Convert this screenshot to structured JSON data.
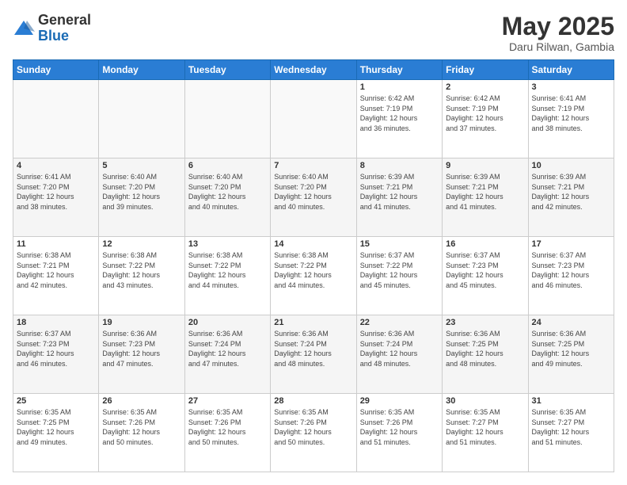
{
  "logo": {
    "general": "General",
    "blue": "Blue"
  },
  "header": {
    "month": "May 2025",
    "location": "Daru Rilwan, Gambia"
  },
  "days_of_week": [
    "Sunday",
    "Monday",
    "Tuesday",
    "Wednesday",
    "Thursday",
    "Friday",
    "Saturday"
  ],
  "weeks": [
    [
      {
        "day": "",
        "info": ""
      },
      {
        "day": "",
        "info": ""
      },
      {
        "day": "",
        "info": ""
      },
      {
        "day": "",
        "info": ""
      },
      {
        "day": "1",
        "info": "Sunrise: 6:42 AM\nSunset: 7:19 PM\nDaylight: 12 hours\nand 36 minutes."
      },
      {
        "day": "2",
        "info": "Sunrise: 6:42 AM\nSunset: 7:19 PM\nDaylight: 12 hours\nand 37 minutes."
      },
      {
        "day": "3",
        "info": "Sunrise: 6:41 AM\nSunset: 7:19 PM\nDaylight: 12 hours\nand 38 minutes."
      }
    ],
    [
      {
        "day": "4",
        "info": "Sunrise: 6:41 AM\nSunset: 7:20 PM\nDaylight: 12 hours\nand 38 minutes."
      },
      {
        "day": "5",
        "info": "Sunrise: 6:40 AM\nSunset: 7:20 PM\nDaylight: 12 hours\nand 39 minutes."
      },
      {
        "day": "6",
        "info": "Sunrise: 6:40 AM\nSunset: 7:20 PM\nDaylight: 12 hours\nand 40 minutes."
      },
      {
        "day": "7",
        "info": "Sunrise: 6:40 AM\nSunset: 7:20 PM\nDaylight: 12 hours\nand 40 minutes."
      },
      {
        "day": "8",
        "info": "Sunrise: 6:39 AM\nSunset: 7:21 PM\nDaylight: 12 hours\nand 41 minutes."
      },
      {
        "day": "9",
        "info": "Sunrise: 6:39 AM\nSunset: 7:21 PM\nDaylight: 12 hours\nand 41 minutes."
      },
      {
        "day": "10",
        "info": "Sunrise: 6:39 AM\nSunset: 7:21 PM\nDaylight: 12 hours\nand 42 minutes."
      }
    ],
    [
      {
        "day": "11",
        "info": "Sunrise: 6:38 AM\nSunset: 7:21 PM\nDaylight: 12 hours\nand 42 minutes."
      },
      {
        "day": "12",
        "info": "Sunrise: 6:38 AM\nSunset: 7:22 PM\nDaylight: 12 hours\nand 43 minutes."
      },
      {
        "day": "13",
        "info": "Sunrise: 6:38 AM\nSunset: 7:22 PM\nDaylight: 12 hours\nand 44 minutes."
      },
      {
        "day": "14",
        "info": "Sunrise: 6:38 AM\nSunset: 7:22 PM\nDaylight: 12 hours\nand 44 minutes."
      },
      {
        "day": "15",
        "info": "Sunrise: 6:37 AM\nSunset: 7:22 PM\nDaylight: 12 hours\nand 45 minutes."
      },
      {
        "day": "16",
        "info": "Sunrise: 6:37 AM\nSunset: 7:23 PM\nDaylight: 12 hours\nand 45 minutes."
      },
      {
        "day": "17",
        "info": "Sunrise: 6:37 AM\nSunset: 7:23 PM\nDaylight: 12 hours\nand 46 minutes."
      }
    ],
    [
      {
        "day": "18",
        "info": "Sunrise: 6:37 AM\nSunset: 7:23 PM\nDaylight: 12 hours\nand 46 minutes."
      },
      {
        "day": "19",
        "info": "Sunrise: 6:36 AM\nSunset: 7:23 PM\nDaylight: 12 hours\nand 47 minutes."
      },
      {
        "day": "20",
        "info": "Sunrise: 6:36 AM\nSunset: 7:24 PM\nDaylight: 12 hours\nand 47 minutes."
      },
      {
        "day": "21",
        "info": "Sunrise: 6:36 AM\nSunset: 7:24 PM\nDaylight: 12 hours\nand 48 minutes."
      },
      {
        "day": "22",
        "info": "Sunrise: 6:36 AM\nSunset: 7:24 PM\nDaylight: 12 hours\nand 48 minutes."
      },
      {
        "day": "23",
        "info": "Sunrise: 6:36 AM\nSunset: 7:25 PM\nDaylight: 12 hours\nand 48 minutes."
      },
      {
        "day": "24",
        "info": "Sunrise: 6:36 AM\nSunset: 7:25 PM\nDaylight: 12 hours\nand 49 minutes."
      }
    ],
    [
      {
        "day": "25",
        "info": "Sunrise: 6:35 AM\nSunset: 7:25 PM\nDaylight: 12 hours\nand 49 minutes."
      },
      {
        "day": "26",
        "info": "Sunrise: 6:35 AM\nSunset: 7:26 PM\nDaylight: 12 hours\nand 50 minutes."
      },
      {
        "day": "27",
        "info": "Sunrise: 6:35 AM\nSunset: 7:26 PM\nDaylight: 12 hours\nand 50 minutes."
      },
      {
        "day": "28",
        "info": "Sunrise: 6:35 AM\nSunset: 7:26 PM\nDaylight: 12 hours\nand 50 minutes."
      },
      {
        "day": "29",
        "info": "Sunrise: 6:35 AM\nSunset: 7:26 PM\nDaylight: 12 hours\nand 51 minutes."
      },
      {
        "day": "30",
        "info": "Sunrise: 6:35 AM\nSunset: 7:27 PM\nDaylight: 12 hours\nand 51 minutes."
      },
      {
        "day": "31",
        "info": "Sunrise: 6:35 AM\nSunset: 7:27 PM\nDaylight: 12 hours\nand 51 minutes."
      }
    ]
  ]
}
